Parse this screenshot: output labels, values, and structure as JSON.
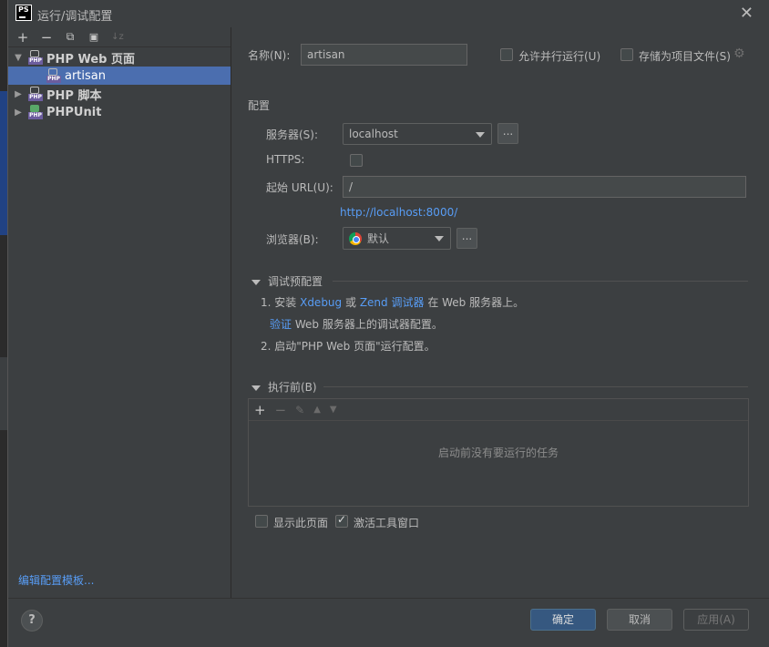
{
  "window": {
    "title": "运行/调试配置",
    "logo_text": "PS"
  },
  "left": {
    "toolbar": {
      "add": "+",
      "remove": "−",
      "copy": "⧉",
      "folder": "▣",
      "sort": "↓z"
    },
    "tree": [
      {
        "label": "PHP Web 页面",
        "expanded": true
      },
      {
        "label": "artisan",
        "selected": true
      },
      {
        "label": "PHP 脚本",
        "expanded": false
      },
      {
        "label": "PHPUnit",
        "expanded": false
      }
    ],
    "edit_templates": "编辑配置模板..."
  },
  "form": {
    "name_label": "名称(N):",
    "name_value": "artisan",
    "allow_parallel": "允许并行运行(U)",
    "store_as_project": "存储为项目文件(S)",
    "config_section": "配置",
    "server_label": "服务器(S):",
    "server_value": "localhost",
    "https_label": "HTTPS:",
    "start_url_label": "起始 URL(U):",
    "start_url_value": "/",
    "resolved_url": "http://localhost:8000/",
    "browser_label": "浏览器(B):",
    "browser_value": "默认",
    "dots": "..."
  },
  "debug": {
    "section_title": "调试预配置",
    "step1_prefix": "1. 安装",
    "xdebug": "Xdebug",
    "or": "或",
    "zend": "Zend 调试器",
    "step1_suffix": "在 Web 服务器上。",
    "verify_link": "验证",
    "verify_suffix": "Web 服务器上的调试器配置。",
    "step2": "2. 启动\"PHP Web 页面\"运行配置。"
  },
  "before_launch": {
    "section_title": "执行前(B)",
    "empty_text": "启动前没有要运行的任务",
    "show_page": "显示此页面",
    "activate_window": "激活工具窗口",
    "show_page_checked": false,
    "activate_window_checked": true
  },
  "buttons": {
    "help": "?",
    "ok": "确定",
    "cancel": "取消",
    "apply": "应用(A)"
  },
  "colors": {
    "selection": "#4b6eaf",
    "link": "#589df6",
    "primary_button": "#365880"
  }
}
